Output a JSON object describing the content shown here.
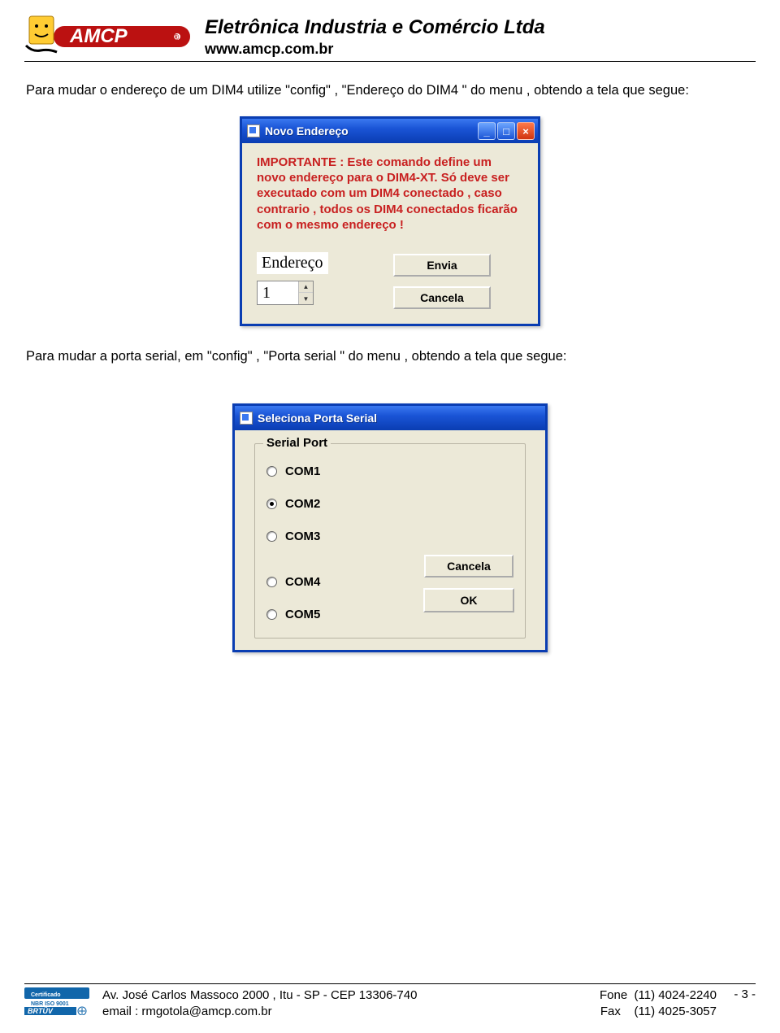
{
  "header": {
    "company": "Eletrônica Industria e Comércio Ltda",
    "url": "www.amcp.com.br"
  },
  "paragraph1": "Para mudar o endereço de um DIM4 utilize \"config\" , \"Endereço do DIM4 \" do menu , obtendo a tela que segue:",
  "window1": {
    "title": "Novo Endereço",
    "warning": "IMPORTANTE : Este comando define um novo endereço para o DIM4-XT. Só deve ser executado com um DIM4 conectado , caso contrario , todos os DIM4 conectados ficarão com o mesmo endereço !",
    "label": "Endereço",
    "value": "1",
    "btn_send": "Envia",
    "btn_cancel": "Cancela"
  },
  "paragraph2": "Para mudar a porta serial, em \"config\" , \"Porta serial \" do menu , obtendo a tela que segue:",
  "window2": {
    "title": "Seleciona Porta Serial",
    "legend": "Serial Port",
    "options": [
      "COM1",
      "COM2",
      "COM3",
      "COM4",
      "COM5"
    ],
    "selected": "COM2",
    "btn_cancel": "Cancela",
    "btn_ok": "OK"
  },
  "footer": {
    "addr": "Av. José Carlos Massoco 2000 , Itu - SP - CEP 13306-740",
    "email": "email : rmgotola@amcp.com.br",
    "phone": "Fone  (11) 4024-2240",
    "fax": "Fax    (11) 4025-3057",
    "page": "- 3 -"
  }
}
